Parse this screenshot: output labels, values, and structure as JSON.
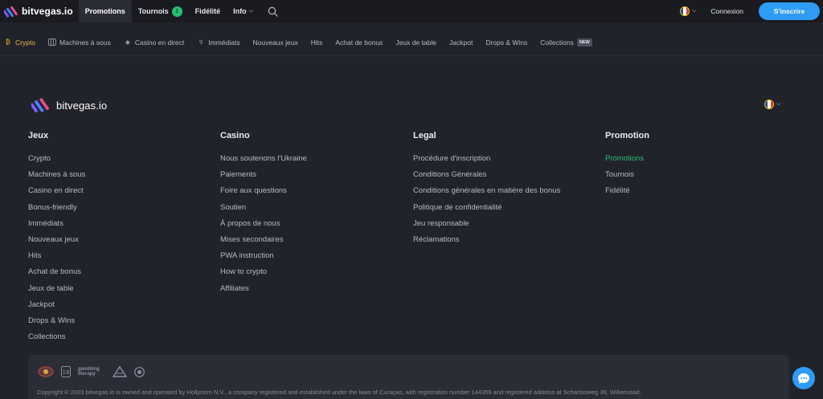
{
  "header": {
    "brand": "bitvegas.io",
    "nav": [
      {
        "label": "Promotions"
      },
      {
        "label": "Tournois",
        "badge": "1"
      },
      {
        "label": "Fidélité"
      },
      {
        "label": "Info"
      }
    ],
    "login_label": "Connexion",
    "signup_label": "S'inscrire"
  },
  "categories": [
    {
      "label": "Crypto",
      "icon": "bitcoin-icon"
    },
    {
      "label": "Machines à sous",
      "icon": "slot-machine-icon"
    },
    {
      "label": "Casino en direct",
      "icon": "live-dice-icon"
    },
    {
      "label": "Immédiats",
      "icon": "lightning-icon"
    },
    {
      "label": "Nouveaux jeux",
      "icon": ""
    },
    {
      "label": "Hits",
      "icon": ""
    },
    {
      "label": "Achat de bonus",
      "icon": ""
    },
    {
      "label": "Jeux de table",
      "icon": ""
    },
    {
      "label": "Jackpot",
      "icon": ""
    },
    {
      "label": "Drops & Wins",
      "icon": ""
    },
    {
      "label": "Collections",
      "icon": "",
      "badge": "NEW"
    }
  ],
  "footer": {
    "brand": "bitvegas.io",
    "columns": [
      {
        "title": "Jeux",
        "items": [
          "Crypto",
          "Machines à sous",
          "Casino en direct",
          "Bonus-friendly",
          "Immédiats",
          "Nouveaux jeux",
          "Hits",
          "Achat de bonus",
          "Jeux de table",
          "Jackpot",
          "Drops & Wins",
          "Collections"
        ]
      },
      {
        "title": "Casino",
        "items": [
          "Nous soutenons l'Ukraine",
          "Paiements",
          "Foire aux questions",
          "Soutien",
          "À propos de nous",
          "Mises secondaires",
          "PWA instruction",
          "How to crypto",
          "Affiliates"
        ]
      },
      {
        "title": "Legal",
        "items": [
          "Procédure d'inscription",
          "Conditions Générales",
          "Conditions générales en matière des bonus",
          "Politique de confidentialité",
          "Jeu responsable",
          "Réclamations"
        ]
      },
      {
        "title": "Promotion",
        "items": [
          "Promotions",
          "Tournois",
          "Fidélité"
        ],
        "highlighted_item": "Promotions"
      }
    ],
    "gambling_therapy_label": "gambling therapy",
    "copyright": "Copyright © 2023 bitvegas.io is owned and operated by Hollycorn N.V., a company registered and established under the laws of Curaçao, with registration number 144359 and registered address at Scharlooweg 39, Willemstad,"
  },
  "colors": {
    "accent_blue": "#2e9cf5",
    "accent_green": "#25c16f",
    "crypto_gold": "#f2b53a",
    "background": "#21232b"
  }
}
